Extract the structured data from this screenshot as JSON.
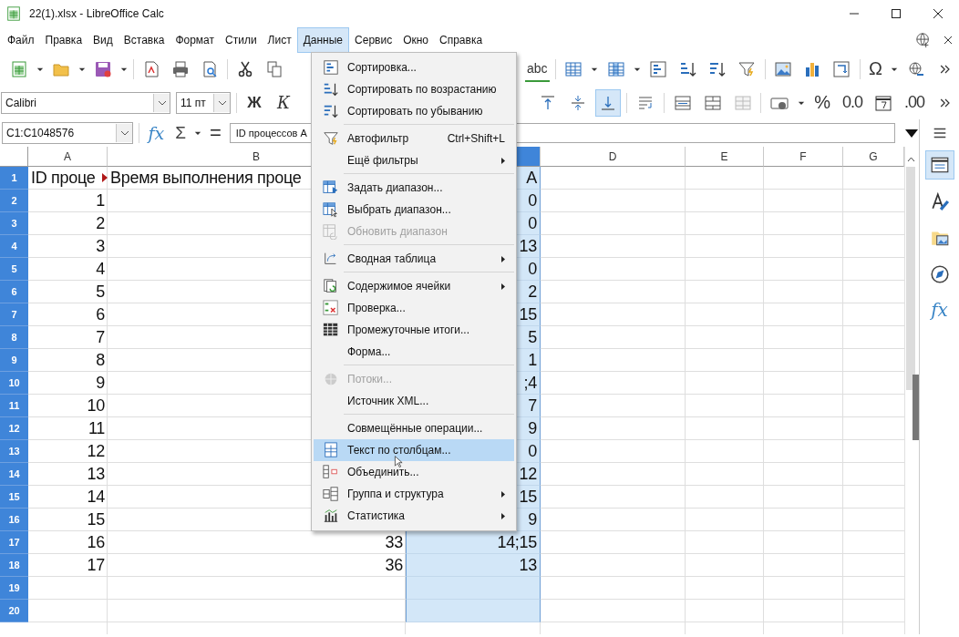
{
  "window": {
    "title": "22(1).xlsx - LibreOffice Calc"
  },
  "menu_bar": [
    {
      "label": "Файл",
      "selected": false
    },
    {
      "label": "Правка",
      "selected": false
    },
    {
      "label": "Вид",
      "selected": false
    },
    {
      "label": "Вставка",
      "selected": false
    },
    {
      "label": "Формат",
      "selected": false
    },
    {
      "label": "Стили",
      "selected": false
    },
    {
      "label": "Лист",
      "selected": false
    },
    {
      "label": "Данные",
      "selected": true
    },
    {
      "label": "Сервис",
      "selected": false
    },
    {
      "label": "Окно",
      "selected": false
    },
    {
      "label": "Справка",
      "selected": false
    }
  ],
  "toolbar": {
    "spelling": "abc",
    "special_character": "Ω"
  },
  "format_bar": {
    "font": "Calibri",
    "size": "11 пт",
    "bold": "Ж",
    "italic": "К",
    "alignment": [
      {
        "selected": false
      },
      {
        "selected": false
      },
      {
        "selected": true
      }
    ],
    "percent": "%",
    "number": "0.0",
    "add_decimal": ".00"
  },
  "formula_bar": {
    "name_box": "C1:C1048576",
    "wizard": "fx",
    "sum": "Σ",
    "formula": "=",
    "content": "ID процессов А"
  },
  "sheet": {
    "columns": [
      {
        "label": "A",
        "selected": false
      },
      {
        "label": "B",
        "selected": false
      },
      {
        "selected": true
      },
      {
        "label": "D",
        "selected": false
      },
      {
        "label": "E",
        "selected": false
      },
      {
        "label": "F",
        "selected": false
      },
      {
        "label": "G",
        "selected": false
      }
    ],
    "rows": [
      {
        "number": "1",
        "kind": "heading",
        "a": "ID проце",
        "a_clipped": true,
        "b": "Время выполнения проце",
        "c": "A"
      },
      {
        "number": "2",
        "kind": "data",
        "a": "1",
        "c": "0"
      },
      {
        "number": "3",
        "kind": "data",
        "a": "2",
        "c": "0"
      },
      {
        "number": "4",
        "kind": "data",
        "a": "3",
        "c": "13"
      },
      {
        "number": "5",
        "kind": "data",
        "a": "4",
        "c": "0"
      },
      {
        "number": "6",
        "kind": "data",
        "a": "5",
        "c": "2"
      },
      {
        "number": "7",
        "kind": "data",
        "a": "6",
        "c": "15"
      },
      {
        "number": "8",
        "kind": "data",
        "a": "7",
        "c": "5"
      },
      {
        "number": "9",
        "kind": "data",
        "a": "8",
        "c": "1"
      },
      {
        "number": "10",
        "kind": "data",
        "a": "9",
        "c": ";4"
      },
      {
        "number": "11",
        "kind": "data",
        "a": "10",
        "c": "7"
      },
      {
        "number": "12",
        "kind": "data",
        "a": "11",
        "c": "9"
      },
      {
        "number": "13",
        "kind": "data",
        "a": "12",
        "c": "0"
      },
      {
        "number": "14",
        "kind": "data",
        "a": "13",
        "c": "12"
      },
      {
        "number": "15",
        "kind": "data",
        "a": "14",
        "c": "15"
      },
      {
        "number": "16",
        "kind": "data",
        "a": "15",
        "c": "9"
      },
      {
        "number": "17",
        "kind": "data",
        "a": "16",
        "b": "33",
        "c": "14;15"
      },
      {
        "number": "18",
        "kind": "data",
        "a": "17",
        "b": "36",
        "c": "13"
      },
      {
        "number": "19",
        "kind": "data"
      },
      {
        "number": "20",
        "kind": "data"
      }
    ]
  },
  "data_menu": {
    "items": [
      {
        "kind": "item",
        "label": "Сортировка...",
        "selected": false,
        "disabled": false,
        "submenu": false
      },
      {
        "kind": "item",
        "label": "Сортировать по возрастанию",
        "selected": false,
        "disabled": false,
        "submenu": false
      },
      {
        "kind": "item",
        "label": "Сортировать по убыванию",
        "selected": false,
        "disabled": false,
        "submenu": false
      },
      {
        "kind": "separator"
      },
      {
        "kind": "item",
        "label": "Автофильтр",
        "shortcut": "Ctrl+Shift+L",
        "selected": false,
        "disabled": false,
        "submenu": false
      },
      {
        "kind": "item",
        "label": "Ещё фильтры",
        "selected": false,
        "disabled": false,
        "submenu": true
      },
      {
        "kind": "separator"
      },
      {
        "kind": "item",
        "label": "Задать диапазон...",
        "selected": false,
        "disabled": false,
        "submenu": false
      },
      {
        "kind": "item",
        "label": "Выбрать диапазон...",
        "selected": false,
        "disabled": false,
        "submenu": false
      },
      {
        "kind": "item",
        "label": "Обновить диапазон",
        "selected": false,
        "disabled": true,
        "submenu": false
      },
      {
        "kind": "separator"
      },
      {
        "kind": "item",
        "label": "Сводная таблица",
        "selected": false,
        "disabled": false,
        "submenu": true
      },
      {
        "kind": "separator"
      },
      {
        "kind": "item",
        "label": "Содержимое ячейки",
        "selected": false,
        "disabled": false,
        "submenu": true
      },
      {
        "kind": "item",
        "label": "Проверка...",
        "selected": false,
        "disabled": false,
        "submenu": false
      },
      {
        "kind": "item",
        "label": "Промежуточные итоги...",
        "selected": false,
        "disabled": false,
        "submenu": false
      },
      {
        "kind": "item",
        "label": "Форма...",
        "selected": false,
        "disabled": false,
        "submenu": false
      },
      {
        "kind": "separator"
      },
      {
        "kind": "item",
        "label": "Потоки...",
        "selected": false,
        "disabled": true,
        "submenu": false
      },
      {
        "kind": "item",
        "label": "Источник XML...",
        "selected": false,
        "disabled": false,
        "submenu": false
      },
      {
        "kind": "separator"
      },
      {
        "kind": "item",
        "label": "Совмещённые операции...",
        "selected": false,
        "disabled": false,
        "submenu": false
      },
      {
        "kind": "item",
        "label": "Текст по столбцам...",
        "selected": true,
        "disabled": false,
        "submenu": false
      },
      {
        "kind": "item",
        "label": "Объединить...",
        "selected": false,
        "disabled": false,
        "submenu": false
      },
      {
        "kind": "item",
        "label": "Группа и структура",
        "selected": false,
        "disabled": false,
        "submenu": true
      },
      {
        "kind": "item",
        "label": "Статистика",
        "selected": false,
        "disabled": false,
        "submenu": true
      }
    ]
  },
  "sidebar": {
    "tabs": [
      {
        "selected": true
      },
      {
        "selected": false
      },
      {
        "selected": false
      },
      {
        "selected": false
      },
      {
        "label": "fx",
        "selected": false
      }
    ]
  }
}
